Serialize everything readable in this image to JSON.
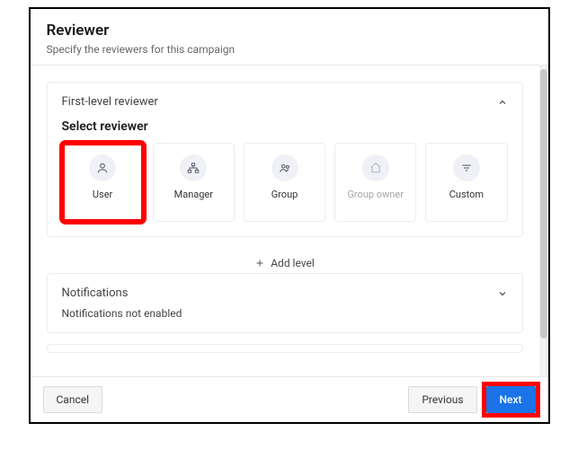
{
  "header": {
    "title": "Reviewer",
    "subtitle": "Specify the reviewers for this campaign"
  },
  "firstLevel": {
    "title": "First-level reviewer",
    "subheading": "Select reviewer",
    "options": [
      {
        "label": "User",
        "icon": "user-icon"
      },
      {
        "label": "Manager",
        "icon": "hierarchy-icon"
      },
      {
        "label": "Group",
        "icon": "group-icon"
      },
      {
        "label": "Group owner",
        "icon": "home-icon"
      },
      {
        "label": "Custom",
        "icon": "filter-icon"
      }
    ]
  },
  "addLevel": {
    "label": "Add level"
  },
  "notifications": {
    "title": "Notifications",
    "status": "Notifications not enabled"
  },
  "footer": {
    "cancel": "Cancel",
    "previous": "Previous",
    "next": "Next"
  }
}
